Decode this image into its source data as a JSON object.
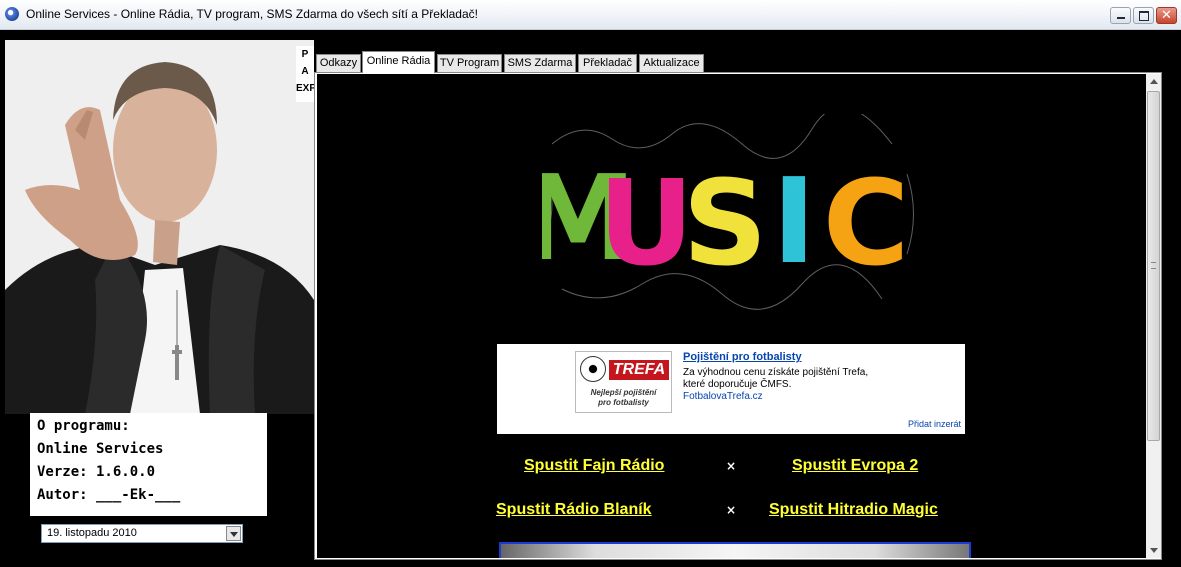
{
  "window": {
    "title": "Online Services - Online Rádia, TV program, SMS Zdarma do všech sítí a Překladač!",
    "colors": {
      "titlebar": "#eef2f8",
      "close": "#c8432d",
      "background": "#000000"
    }
  },
  "sidebar": {
    "banner_letters": [
      "P",
      "A",
      "EXP"
    ],
    "about": {
      "heading": "O programu:",
      "name": "Online Services",
      "version": "Verze: 1.6.0.0",
      "author": "Autor: ___-Ek-___"
    },
    "date_select": {
      "value": "19. listopadu 2010"
    }
  },
  "tabs": [
    {
      "label": "Odkazy",
      "active": false
    },
    {
      "label": "Online Rádia",
      "active": true
    },
    {
      "label": "TV Program",
      "active": false
    },
    {
      "label": "SMS Zdarma",
      "active": false
    },
    {
      "label": "Překladač",
      "active": false
    },
    {
      "label": "Aktualizace",
      "active": false
    }
  ],
  "content": {
    "logo_letters": [
      "M",
      "U",
      "S",
      "I",
      "C"
    ],
    "logo_colors": [
      "#6fb83a",
      "#e8208a",
      "#f0e23a",
      "#2ec3d6",
      "#f5a313"
    ],
    "ad": {
      "brand": "TREFA",
      "slogan_line1": "Nejlepší pojištění",
      "slogan_line2": "pro fotbalisty",
      "title": "Pojištění pro fotbalisty",
      "line1": "Za výhodnou cenu získáte pojištění Trefa,",
      "line2": "které doporučuje ČMFS.",
      "url": "FotbalovaTrefa.cz",
      "add_ad": "Přidat inzerát"
    },
    "radios": [
      {
        "label": "Spustit Fajn Rádio"
      },
      {
        "label": "Spustit Evropa 2"
      },
      {
        "label": "Spustit Rádio Blaník "
      },
      {
        "label": "Spustit Hitradio Magic"
      }
    ],
    "separator": "×",
    "link_color": "#ffff33"
  }
}
